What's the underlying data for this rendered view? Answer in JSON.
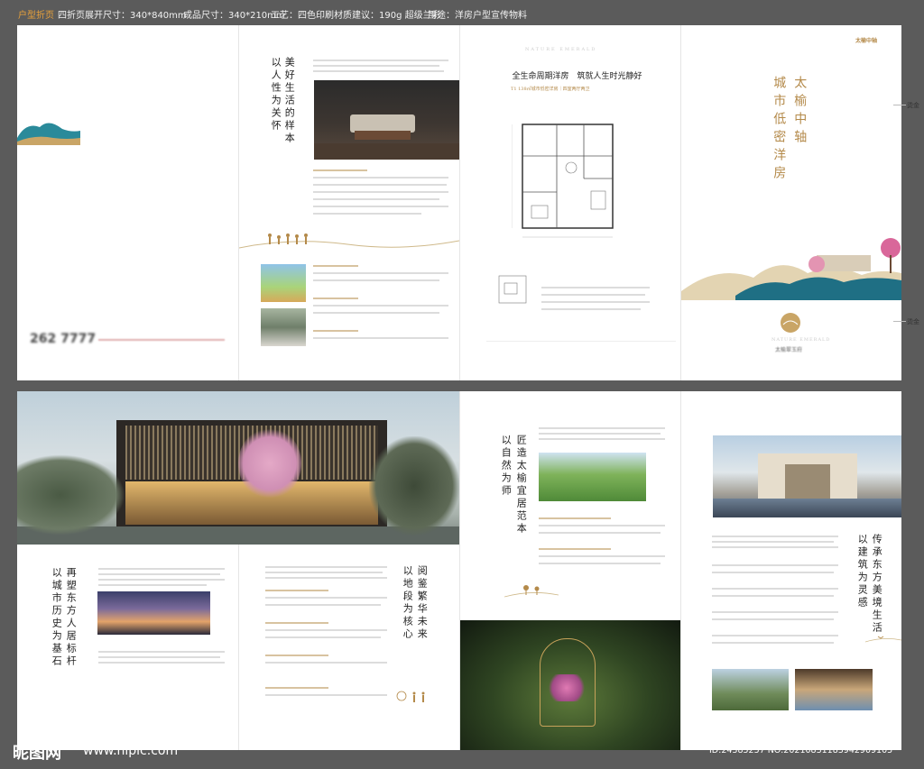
{
  "header": {
    "title": "户型折页",
    "fold": "四折页",
    "unfold_size": "展开尺寸：340*840mm",
    "final_size": "成品尺寸：340*210mm",
    "process": "工艺：四色印刷",
    "material": "材质建议：190g 超级兰彩",
    "usage": "用途：洋房户型宣传物料"
  },
  "top_row": {
    "panel1": {
      "phone_prefix": "262",
      "phone_suffix": "7777"
    },
    "panel2": {
      "headline_col1": "美好生活的样本",
      "headline_col2": "以人性为关怀"
    },
    "panel3": {
      "subtitle_en": "NATURE EMERALD",
      "title": "全生命周期洋房　筑就人生时光静好",
      "subtitle": "T1 138㎡城市低密洋房｜四室两厅两卫"
    },
    "panel4": {
      "logo": "太榆中轴",
      "headline_col1": "太榆中轴",
      "headline_col2": "城市低密洋房",
      "brand_en": "NATURE EMERALD",
      "brand_cn": "太榆翠玉府",
      "hot_stamp_top": "烫金",
      "hot_stamp_bottom": "烫金"
    }
  },
  "bottom_row": {
    "panel1": {
      "headline_col1": "再塑东方人居标杆",
      "headline_col2": "以城市历史为基石"
    },
    "panel2": {
      "headline_col1": "阅鉴繁华未来",
      "headline_col2": "以地段为核心"
    },
    "panel3": {
      "headline_col1": "匠造太榆宜居范本",
      "headline_col2": "以自然为师"
    },
    "panel4": {
      "headline_col1": "传承东方美境生活",
      "headline_col2": "以建筑为灵感"
    }
  },
  "footer": {
    "site_logo": "昵图网",
    "site_url": "www.nipic.com",
    "image_id": "ID:24385257 NO:20210831183942909105"
  },
  "colors": {
    "frame": "#5b5b5b",
    "gold": "#b48a4a",
    "accent_orange": "#e9a23b"
  }
}
